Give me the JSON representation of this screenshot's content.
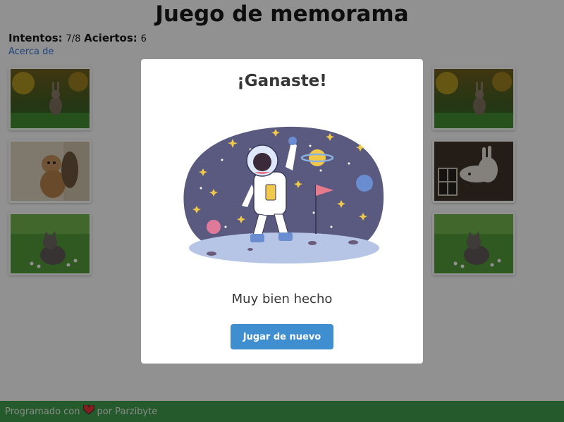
{
  "page_title": "Juego de memorama",
  "stats": {
    "attempts_label": "Intentos:",
    "attempts_value": "7/8",
    "hits_label": "Aciertos:",
    "hits_value": "6"
  },
  "about_link": "Acerca de",
  "cards": {
    "left": [
      "rabbit-photo",
      "lion-cub-photo",
      "kitten-photo"
    ],
    "right": [
      "rabbit-photo",
      "llama-photo",
      "kitten-photo"
    ]
  },
  "modal": {
    "title": "¡Ganaste!",
    "subtitle": "Muy bien hecho",
    "button": "Jugar de nuevo",
    "illustration": "astronaut-on-moon-illustration"
  },
  "footer": {
    "text_before": "Programado con",
    "heart_icon": "heart-icon",
    "text_after": "por Parzibyte"
  },
  "colors": {
    "button": "#3e8ed0",
    "link": "#3273dc",
    "footer": "#3a9b47",
    "heart": "#e03030"
  }
}
